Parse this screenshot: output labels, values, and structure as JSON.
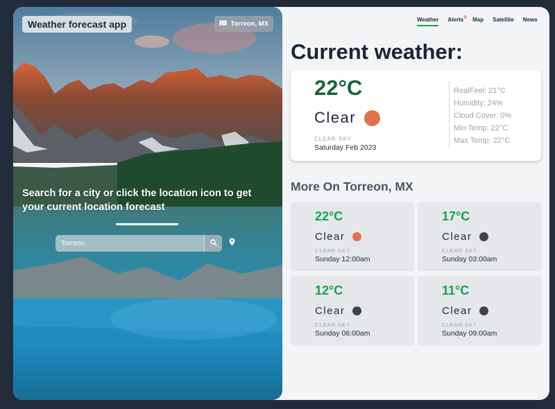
{
  "app": {
    "title": "Weather forecast app",
    "location_badge": "Torreon, MX",
    "location_badge_icon": "map-icon"
  },
  "hero": {
    "prompt": "Search for a city or click the location icon to get your current location forecast",
    "search": {
      "value": "Torreon",
      "placeholder": ""
    },
    "search_icon": "search-icon",
    "location_icon": "map-pin-icon"
  },
  "nav": {
    "items": [
      {
        "label": "Weather",
        "active": true
      },
      {
        "label": "Alerts",
        "badge": true
      },
      {
        "label": "Map"
      },
      {
        "label": "Satellite"
      },
      {
        "label": "News"
      }
    ]
  },
  "current": {
    "heading": "Current weather:",
    "temperature": "22°C",
    "condition": "Clear",
    "condition_color": "#e5704f",
    "description": "CLEAR SKY",
    "date": "Saturday Feb 2023",
    "details": [
      "RealFeel: 21°C",
      "Humidity: 24%",
      "Cloud Cover: 0%",
      "Min Temp: 22°C",
      "Max Temp: 22°C"
    ]
  },
  "more": {
    "heading": "More On Torreon, MX",
    "forecasts": [
      {
        "temperature": "22°C",
        "condition": "Clear",
        "dot_color": "#e5704f",
        "description": "CLEAR SKY",
        "time": "Sunday 12:00am"
      },
      {
        "temperature": "17°C",
        "condition": "Clear",
        "dot_color": "#3f4246",
        "description": "CLEAR SKY",
        "time": "Sunday 03:00am"
      },
      {
        "temperature": "12°C",
        "condition": "Clear",
        "dot_color": "#3f4246",
        "description": "CLEAR SKY",
        "time": "Sunday 06:00am"
      },
      {
        "temperature": "11°C",
        "condition": "Clear",
        "dot_color": "#3f4246",
        "description": "CLEAR SKY",
        "time": "Sunday 09:00am"
      }
    ]
  },
  "colors": {
    "accent_green": "#16a34a",
    "temp_dark_green": "#166534",
    "sun_orange": "#e5704f",
    "moon_dark": "#3f4246"
  }
}
